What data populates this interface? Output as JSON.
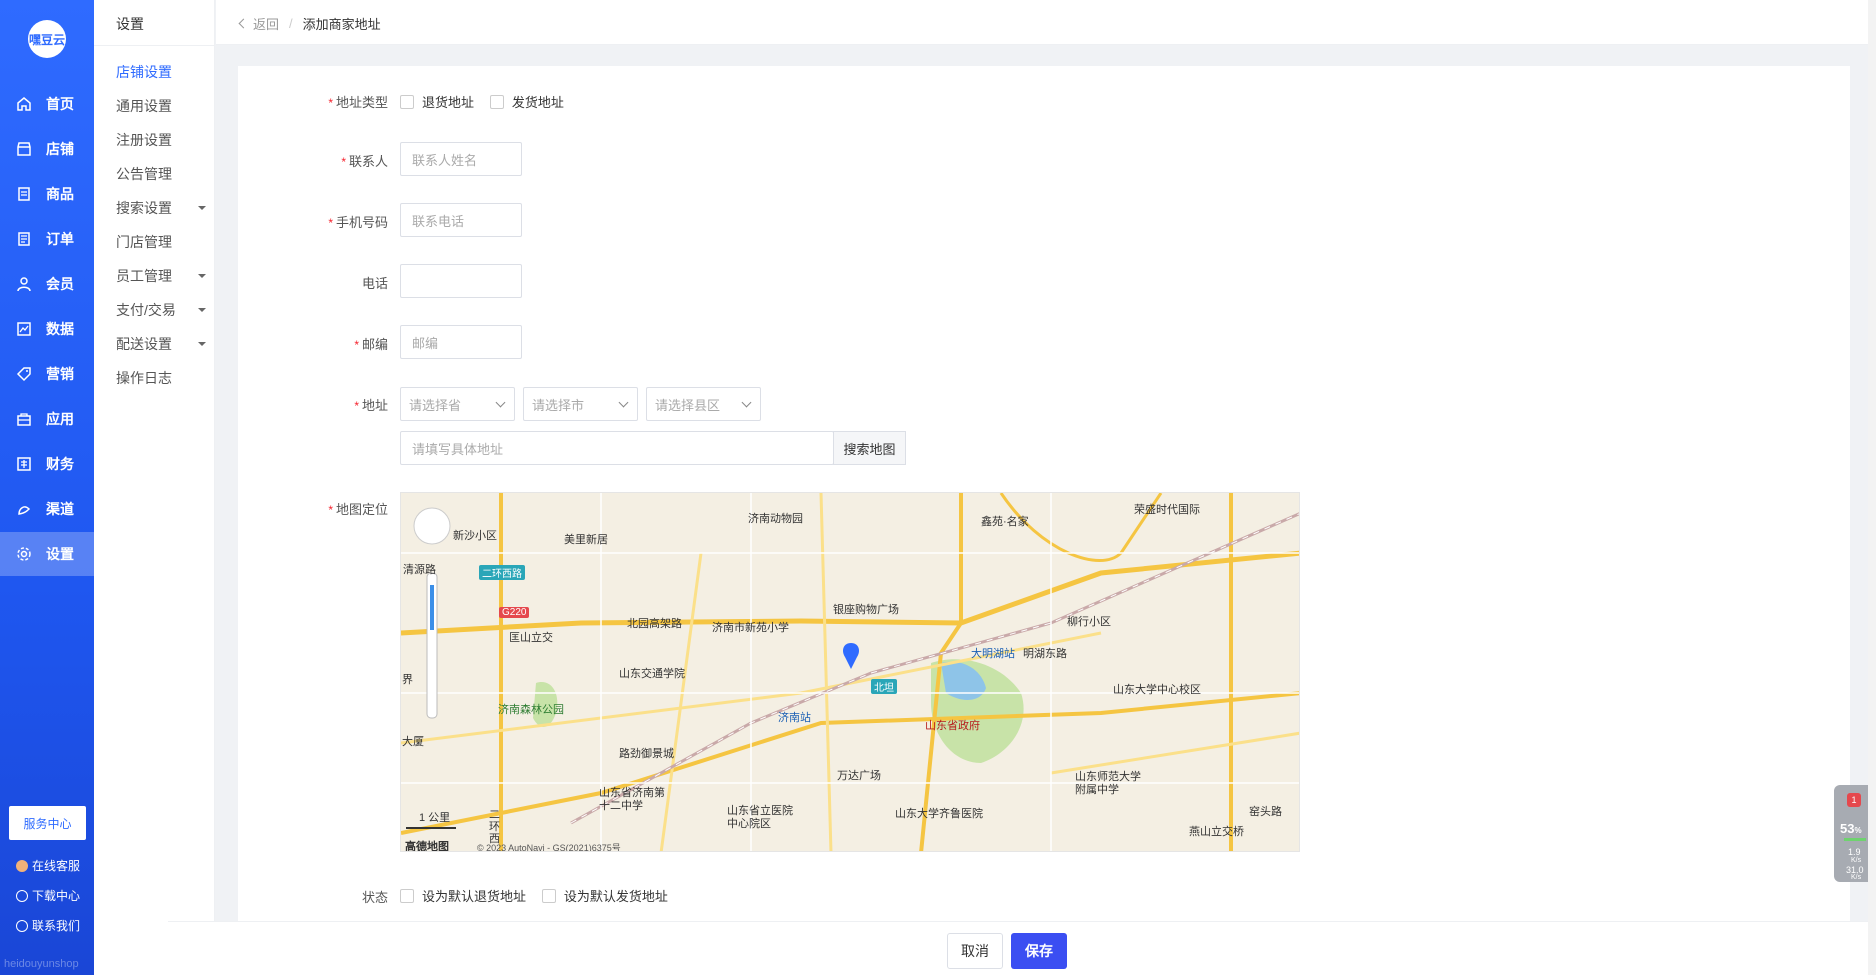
{
  "nav": {
    "logo": "嘿豆云",
    "items": [
      {
        "label": "首页",
        "icon": "home-icon"
      },
      {
        "label": "店铺",
        "icon": "store-icon"
      },
      {
        "label": "商品",
        "icon": "goods-icon"
      },
      {
        "label": "订单",
        "icon": "order-icon"
      },
      {
        "label": "会员",
        "icon": "user-icon"
      },
      {
        "label": "数据",
        "icon": "chart-icon"
      },
      {
        "label": "营销",
        "icon": "tag-icon"
      },
      {
        "label": "应用",
        "icon": "bag-icon"
      },
      {
        "label": "财务",
        "icon": "finance-icon"
      },
      {
        "label": "渠道",
        "icon": "channel-icon"
      },
      {
        "label": "设置",
        "icon": "gear-icon"
      }
    ],
    "service_center": "服务中心",
    "footer_links": [
      "在线客服",
      "下载中心",
      "联系我们"
    ],
    "watermark": "heidouyunshop"
  },
  "subnav": {
    "title": "设置",
    "items": [
      {
        "label": "店铺设置"
      },
      {
        "label": "通用设置"
      },
      {
        "label": "注册设置"
      },
      {
        "label": "公告管理"
      },
      {
        "label": "搜索设置"
      },
      {
        "label": "门店管理"
      },
      {
        "label": "员工管理"
      },
      {
        "label": "支付/交易"
      },
      {
        "label": "配送设置"
      },
      {
        "label": "操作日志"
      }
    ]
  },
  "breadcrumb": {
    "back": "返回",
    "current": "添加商家地址"
  },
  "form": {
    "address_type_label": "地址类型",
    "return_address": "退货地址",
    "ship_address": "发货地址",
    "contact_label": "联系人",
    "contact_placeholder": "联系人姓名",
    "mobile_label": "手机号码",
    "mobile_placeholder": "联系电话",
    "phone_label": "电话",
    "phone_placeholder": "",
    "zip_label": "邮编",
    "zip_placeholder": "邮编",
    "address_label": "地址",
    "province_placeholder": "请选择省",
    "city_placeholder": "请选择市",
    "district_placeholder": "请选择县区",
    "detail_placeholder": "请填写具体地址",
    "search_map": "搜索地图",
    "map_label": "地图定位",
    "status_label": "状态",
    "default_return": "设为默认退货地址",
    "default_ship": "设为默认发货地址"
  },
  "map": {
    "pois": [
      "济南动物园",
      "新沙小区",
      "美里新居",
      "鑫苑·名家",
      "荣盛时代国际",
      "二环西路",
      "银座购物广场",
      "柳行小区",
      "北园高架路",
      "济南市新苑小学",
      "匡山立交",
      "大明湖站",
      "明湖东路",
      "山东交通学院",
      "北坦",
      "山东大学中心校区",
      "济南森林公园",
      "济南站",
      "山东省政府",
      "路劲御景城",
      "万达广场",
      "山东师范大学附属中学",
      "山东省济南第十二中学",
      "山东省立医院中心院区",
      "山东大学齐鲁医院",
      "燕山立交桥",
      "窑头路",
      "1 公里",
      "二环西",
      "高德地图",
      "© 2023 AutoNavi - GS(2021)6375号",
      "清源路",
      "G220",
      "界",
      "大厦"
    ]
  },
  "footer": {
    "cancel": "取消",
    "save": "保存"
  },
  "widget": {
    "score": "53",
    "unit": "%",
    "up": "1.9",
    "up_unit": "K/s",
    "down": "31.0",
    "down_unit": "K/s",
    "badge": "1"
  },
  "colors": {
    "primary": "#2f6bff",
    "save": "#3b4ef2",
    "required": "#f5222d"
  }
}
